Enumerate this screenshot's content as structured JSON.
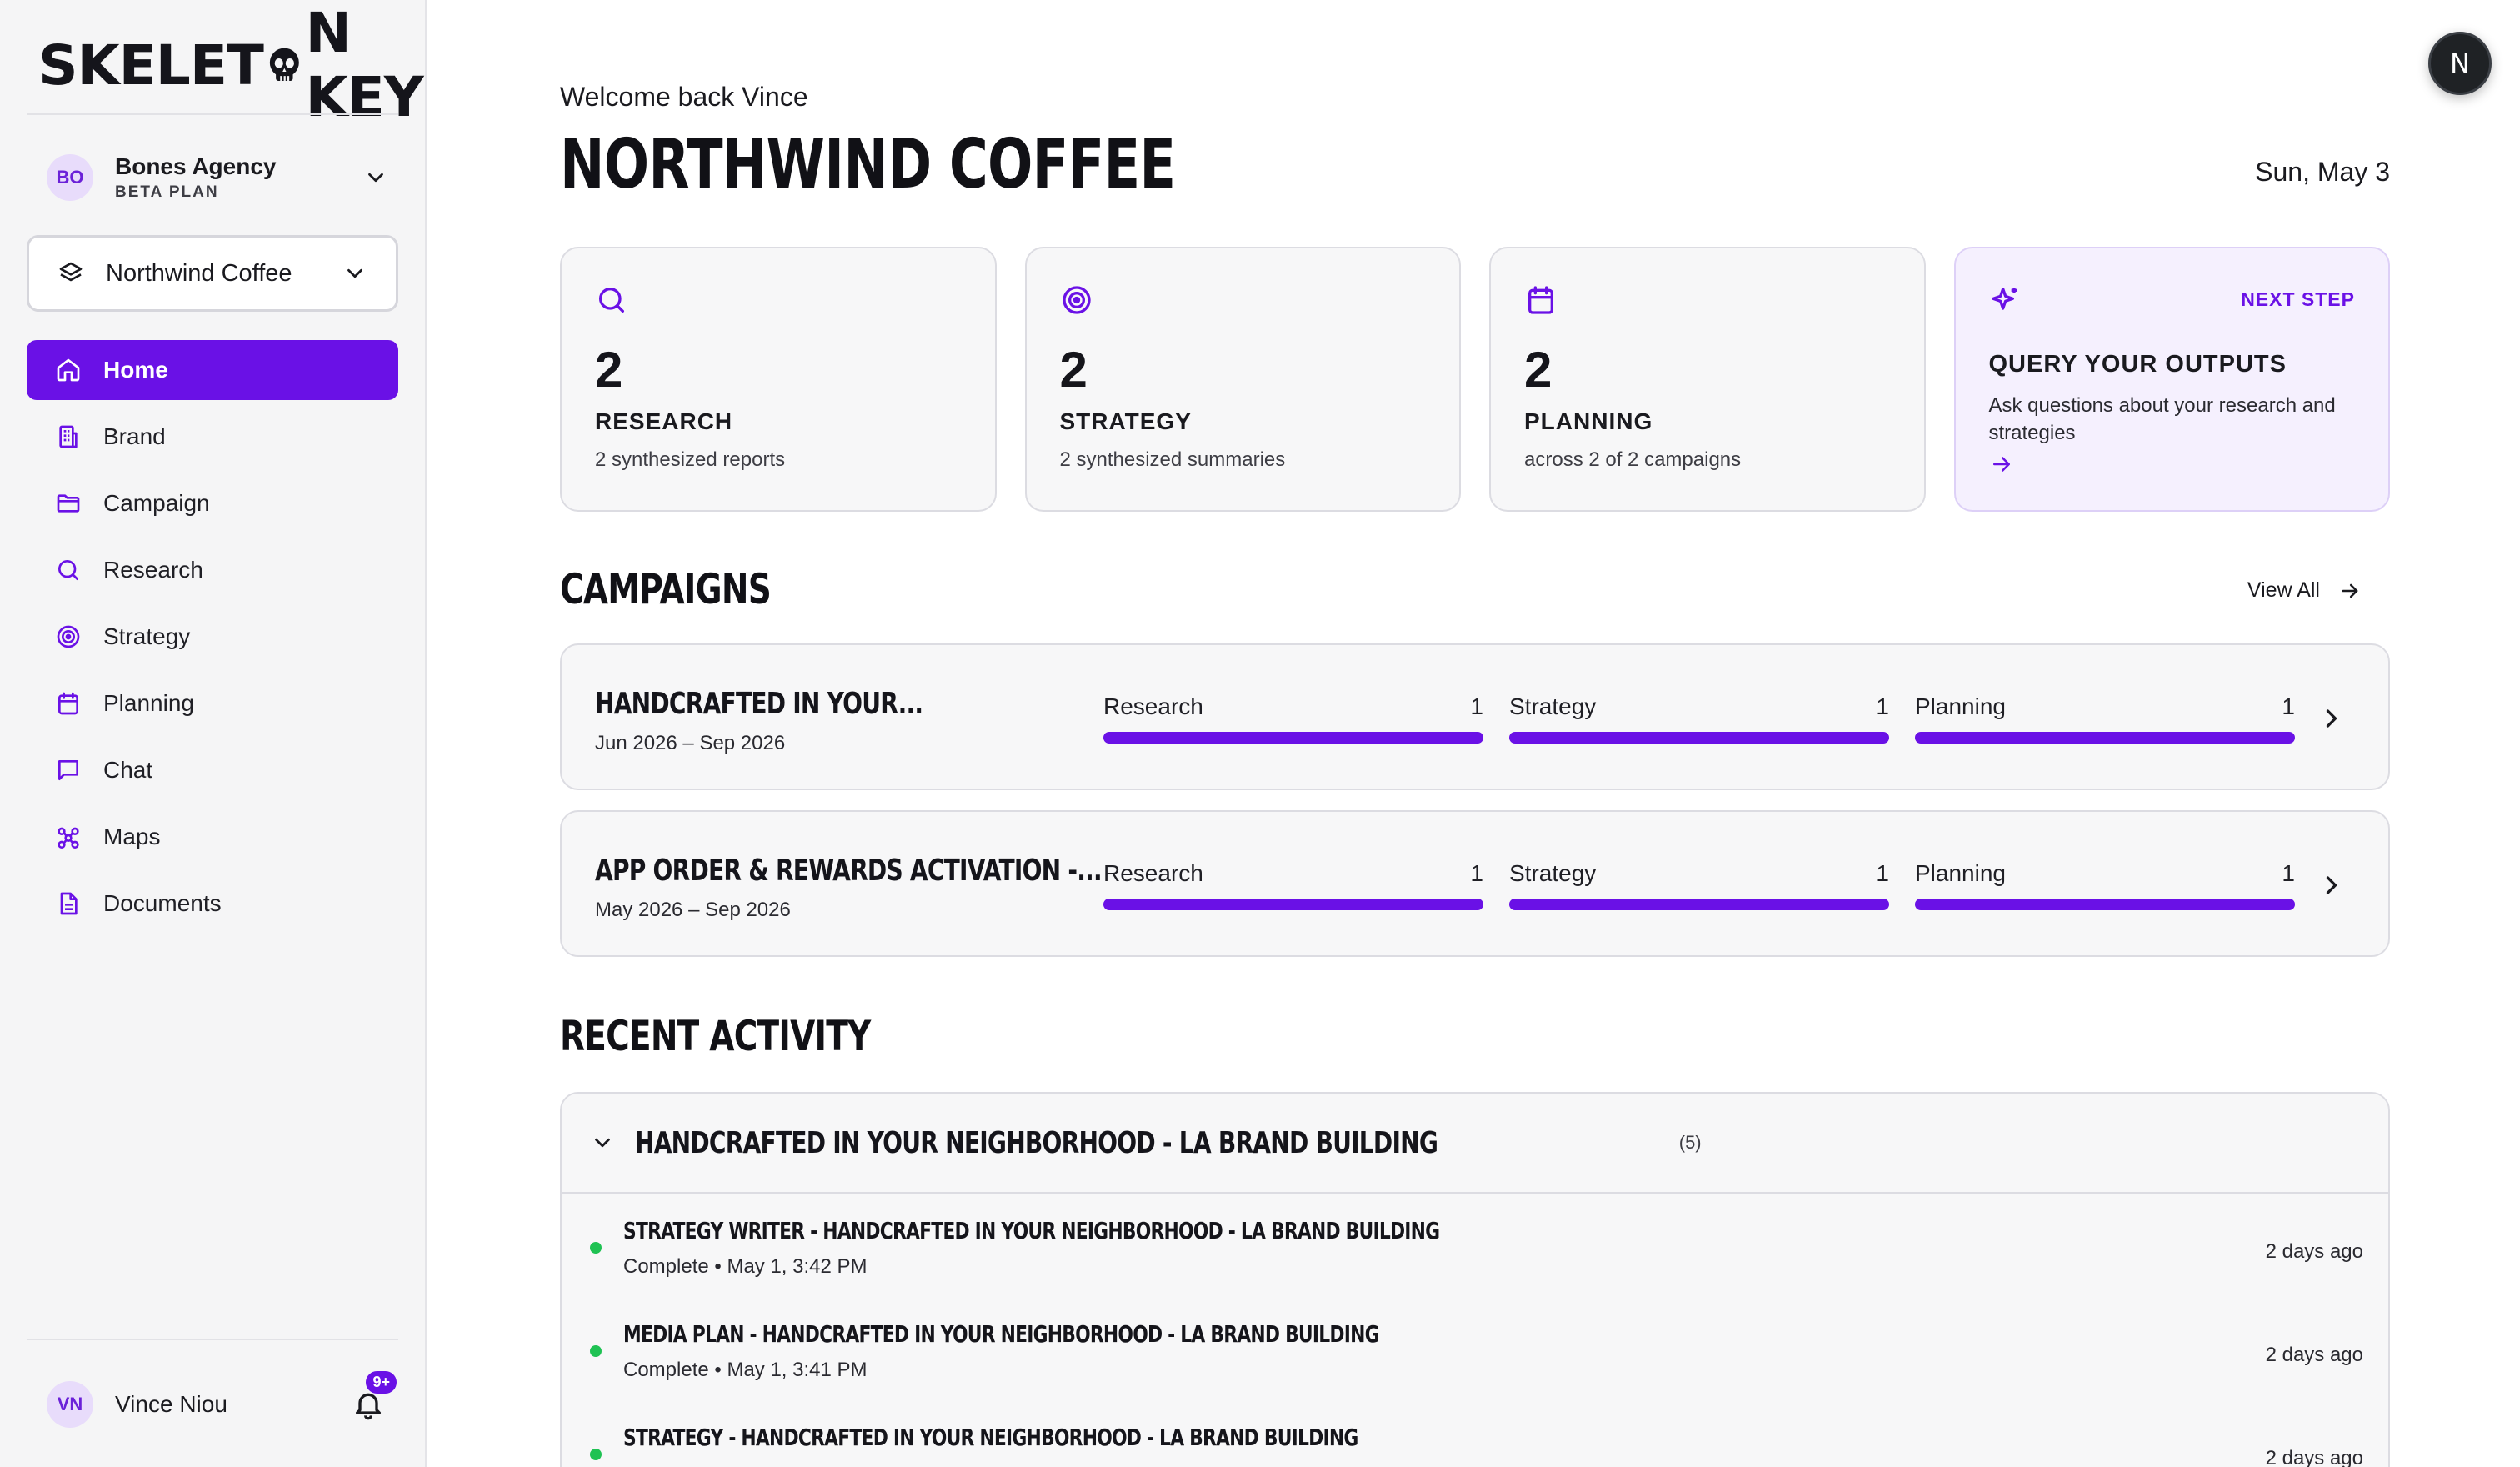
{
  "app": {
    "logo_left": "SKELET",
    "logo_right": "N KEY"
  },
  "org": {
    "initials": "BO",
    "name": "Bones Agency",
    "plan": "BETA PLAN"
  },
  "brand_selector": {
    "value": "Northwind Coffee"
  },
  "nav": {
    "items": [
      {
        "label": "Home",
        "icon": "home-icon",
        "active": true
      },
      {
        "label": "Brand",
        "icon": "building-icon"
      },
      {
        "label": "Campaign",
        "icon": "folder-icon"
      },
      {
        "label": "Research",
        "icon": "search-icon"
      },
      {
        "label": "Strategy",
        "icon": "target-icon"
      },
      {
        "label": "Planning",
        "icon": "calendar-icon"
      },
      {
        "label": "Chat",
        "icon": "chat-icon"
      },
      {
        "label": "Maps",
        "icon": "map-nodes-icon"
      },
      {
        "label": "Documents",
        "icon": "document-icon"
      }
    ]
  },
  "user": {
    "initials": "VN",
    "name": "Vince Niou",
    "notifications": "9+"
  },
  "header": {
    "welcome": "Welcome back Vince",
    "title": "NORTHWIND COFFEE",
    "date": "Sun, May 3"
  },
  "stats": [
    {
      "icon": "search-icon",
      "number": "2",
      "caption": "RESEARCH",
      "sub": "2 synthesized reports"
    },
    {
      "icon": "target-icon",
      "number": "2",
      "caption": "STRATEGY",
      "sub": "2 synthesized summaries"
    },
    {
      "icon": "calendar-icon",
      "number": "2",
      "caption": "PLANNING",
      "sub": "across 2 of 2 campaigns"
    }
  ],
  "next_step": {
    "tag": "NEXT STEP",
    "caption": "QUERY YOUR OUTPUTS",
    "sub": "Ask questions about your research and strategies"
  },
  "campaigns": {
    "heading": "CAMPAIGNS",
    "view_all": "View All",
    "items": [
      {
        "name": "HANDCRAFTED IN YOUR...",
        "dates": "Jun 2026 – Sep 2026",
        "research_label": "Research",
        "research_count": "1",
        "research_progress": 1.0,
        "strategy_label": "Strategy",
        "strategy_count": "1",
        "strategy_progress": 1.0,
        "planning_label": "Planning",
        "planning_count": "1",
        "planning_progress": 1.0
      },
      {
        "name": "APP ORDER & REWARDS ACTIVATION -...",
        "dates": "May 2026 – Sep 2026",
        "research_label": "Research",
        "research_count": "1",
        "research_progress": 1.0,
        "strategy_label": "Strategy",
        "strategy_count": "1",
        "strategy_progress": 1.0,
        "planning_label": "Planning",
        "planning_count": "1",
        "planning_progress": 1.0
      }
    ]
  },
  "activity": {
    "heading": "RECENT ACTIVITY",
    "group_name": "HANDCRAFTED IN YOUR NEIGHBORHOOD - LA BRAND BUILDING",
    "group_count": "(5)",
    "items": [
      {
        "title": "STRATEGY WRITER - HANDCRAFTED IN YOUR NEIGHBORHOOD - LA BRAND BUILDING",
        "meta": "Complete • May 1, 3:42 PM",
        "ago": "2 days ago"
      },
      {
        "title": "MEDIA PLAN - HANDCRAFTED IN YOUR NEIGHBORHOOD - LA BRAND BUILDING",
        "meta": "Complete • May 1, 3:41 PM",
        "ago": "2 days ago"
      },
      {
        "title": "STRATEGY - HANDCRAFTED IN YOUR NEIGHBORHOOD - LA BRAND BUILDING",
        "meta": "",
        "ago": "2 days ago"
      }
    ]
  },
  "corner_badge": "N",
  "colors": {
    "accent": "#6a11e6",
    "success": "#1fc253",
    "sidebar_bg": "#f5f5f6"
  }
}
